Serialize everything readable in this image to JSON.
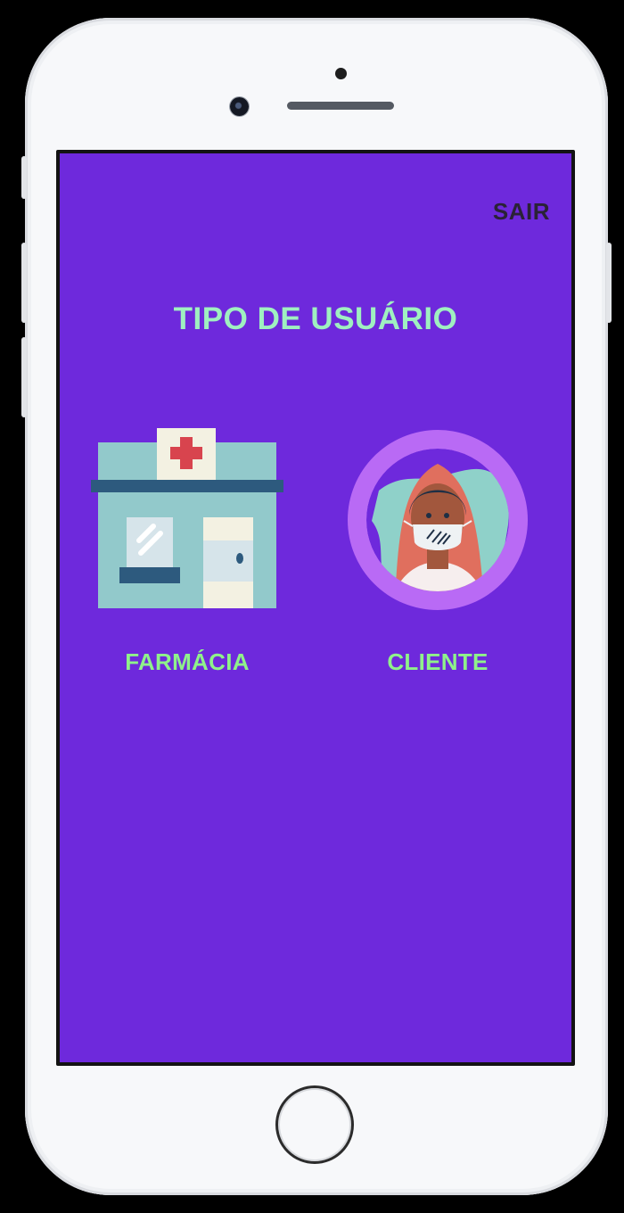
{
  "header": {
    "logout_label": "SAIR"
  },
  "main": {
    "title": "TIPO DE USUÁRIO",
    "options": [
      {
        "label": "FARMÁCIA",
        "icon": "pharmacy-building-icon"
      },
      {
        "label": "CLIENTE",
        "icon": "client-avatar-icon"
      }
    ]
  },
  "colors": {
    "background": "#6e29dc",
    "title": "#9ff0c0",
    "option_label": "#8ff28a",
    "logout": "#2a2236"
  }
}
